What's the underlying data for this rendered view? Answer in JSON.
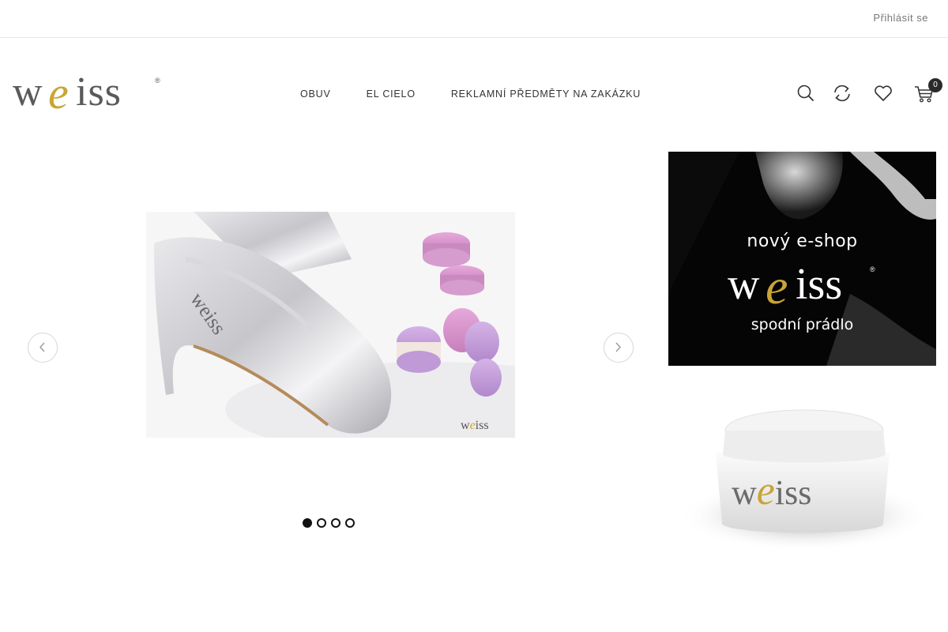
{
  "topbar": {
    "login_label": "Přihlásit se"
  },
  "brand": {
    "logo_text": "weiss",
    "accent_color": "#c9a536",
    "text_color": "#555555"
  },
  "nav": {
    "items": [
      {
        "label": "OBUV"
      },
      {
        "label": "EL CIELO"
      },
      {
        "label": "REKLAMNÍ PŘEDMĚTY NA ZAKÁZKU"
      }
    ]
  },
  "tools": {
    "search_icon": "search-icon",
    "compare_icon": "compare-icon",
    "wishlist_icon": "heart-icon",
    "cart_icon": "cart-icon",
    "cart_count": "0"
  },
  "slider": {
    "active_index": 0,
    "slide_count": 4,
    "slide_logo_text": "weiss"
  },
  "banners": {
    "eshop": {
      "line1": "nový  e-shop",
      "logo_text": "weiss",
      "line2": "spodní prádlo"
    },
    "cosmetics": {
      "logo_text": "weiss"
    }
  }
}
